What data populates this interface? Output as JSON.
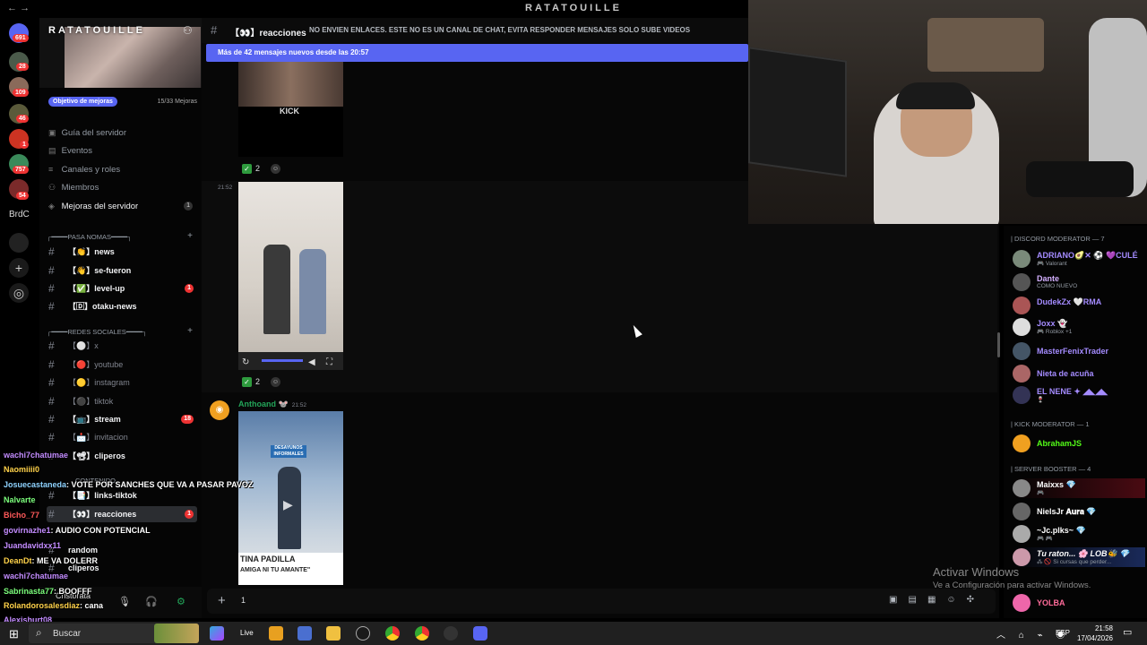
{
  "window": {
    "title": "RATATOUILLE",
    "back_icon": "←",
    "forward_icon": "→"
  },
  "servers": [
    {
      "badge": "691"
    },
    {
      "badge": "28"
    },
    {
      "badge": "109"
    },
    {
      "badge": "46"
    },
    {
      "badge": "1"
    },
    {
      "badge": "757"
    },
    {
      "badge": "54"
    }
  ],
  "server_rail_text": "BrdC",
  "server": {
    "name": "RATATOUILLE",
    "goal_label": "Objetivo de mejoras",
    "goal_count": "15/33 Mejoras"
  },
  "menu": [
    {
      "label": "Guía del servidor"
    },
    {
      "label": "Eventos"
    },
    {
      "label": "Canales y roles"
    },
    {
      "label": "Miembros"
    },
    {
      "label": "Mejoras del servidor",
      "count": "1"
    }
  ],
  "categories": {
    "pasa_nomas": "┌━━━━PASA NOMAS━━━━┐",
    "redes": "┌━━━━REDES SOCIALES━━━━┐",
    "contenido": "CONTENIDO"
  },
  "channels": [
    {
      "label": "【👏】news"
    },
    {
      "label": "【👋】se-fueron"
    },
    {
      "label": "【✅】level-up",
      "badge": "1"
    },
    {
      "label": "【🄳】otaku-news"
    },
    {
      "label": "【⚪】x"
    },
    {
      "label": "【🔴】youtube"
    },
    {
      "label": "【🟡】instagram"
    },
    {
      "label": "【⚫】tiktok"
    },
    {
      "label": "【📺】stream",
      "badge": "18"
    },
    {
      "label": "【📩】invitacion"
    },
    {
      "label": "【📽】cliperos"
    },
    {
      "label": "【📑】links-tiktok"
    },
    {
      "label": "【👀】reacciones",
      "badge": "1"
    },
    {
      "label": "random"
    },
    {
      "label": "cliperos"
    }
  ],
  "user": {
    "name": "Cristorata"
  },
  "chat_overlay": [
    {
      "user": "wachi7chatumae",
      "text": ""
    },
    {
      "user": "Naomiiii0",
      "text": ""
    },
    {
      "user": "Josuecastaneda",
      "text": ": VOTE POR SANCHES QUE VA A PASAR PAVOZ"
    },
    {
      "user": "Nalvarte",
      "text": ""
    },
    {
      "user": "Bicho_77",
      "text": ""
    },
    {
      "user": "govirnazhe1",
      "text": ": AUDIO CON POTENCIAL"
    },
    {
      "user": "Juandavidxx11",
      "text": ""
    },
    {
      "user": "DeanDt",
      "text": ": ME VA DOLERR"
    },
    {
      "user": "wachi7chatumae",
      "text": ""
    },
    {
      "user": "Sabrinasta77",
      "text": ": BOOFFF"
    },
    {
      "user": "Rolandorosalesdiaz",
      "text": ": cana"
    },
    {
      "user": "Alexishurt08",
      "text": ""
    }
  ],
  "channel_header": {
    "name": "【👀】reacciones",
    "topic": "NO ENVIEN ENLACES. ESTE NO ES UN CANAL DE CHAT, EVITA RESPONDER MENSAJES SOLO SUBE VIDEOS"
  },
  "new_messages_bar": "Más de 42 mensajes nuevos desde las 20:57",
  "messages": [
    {
      "media_text": "KICK",
      "reaction_count": "2"
    },
    {
      "time": "21:52",
      "reaction_count": "2"
    },
    {
      "author": "Anthoand 🐭",
      "time": "21:52",
      "media_caption_top": "DESAYUNOS INFORMALES",
      "media_caption": "TINA PADILLA",
      "media_caption2": "AMIGA NI TU AMANTE\""
    }
  ],
  "composer": {
    "value": "1"
  },
  "member_groups": [
    {
      "header": "| DISCORD MODERATOR — 7",
      "members": [
        {
          "name": "ADRIANO🥑✕ ⚽ 💜CULÉ",
          "status": "🎮 Valorant",
          "color": "#a48bff"
        },
        {
          "name": "Dante",
          "status": "COMO NUEVO",
          "color": "#d4b0ff"
        },
        {
          "name": "DudekZx 🤍RMA",
          "status": "",
          "color": "#a48bff"
        },
        {
          "name": "Joxx 👻",
          "status": "🎮 Roblox +1",
          "color": "#a48bff"
        },
        {
          "name": "MasterFenixTrader",
          "status": "",
          "color": "#a48bff"
        },
        {
          "name": "Nieta de acuña",
          "status": "",
          "color": "#a48bff"
        },
        {
          "name": "EL NENE ✦ ◢◣◢◣",
          "status": "🍷",
          "color": "#a48bff"
        }
      ]
    },
    {
      "header": "| KICK MODERATOR — 1",
      "members": [
        {
          "name": "AbrahamJS",
          "status": "",
          "color": "#53fc18"
        }
      ]
    },
    {
      "header": "| SERVER BOOSTER — 4",
      "members": [
        {
          "name": "Maixxs 💎",
          "status": "🎮",
          "color": "#ffffff"
        },
        {
          "name": "NielsJr 𝐀𝐮𝐫𝐚 💎",
          "status": "",
          "color": "#ffffff"
        },
        {
          "name": "~Jc.plks~ 💎",
          "status": "🎮 🎮",
          "color": "#ffffff"
        },
        {
          "name": "Tu raton... 🌸 LOB🐝 💎",
          "status": "⁂ 🚫 Si cursas que perder...",
          "color": "#ffffff"
        },
        {
          "name": "YOLBA",
          "status": "",
          "color": "#ff6b9a"
        }
      ]
    }
  ],
  "watermark": {
    "line1": "Activar Windows",
    "line2": "Ve a Configuración para activar Windows."
  },
  "taskbar": {
    "search": "Buscar",
    "live": "Live",
    "lang": "ESP",
    "time": "21:58",
    "date": "17/04/2026"
  },
  "colors": {
    "accent": "#5865f2",
    "online": "#23a559",
    "badge": "#e33e3e"
  }
}
